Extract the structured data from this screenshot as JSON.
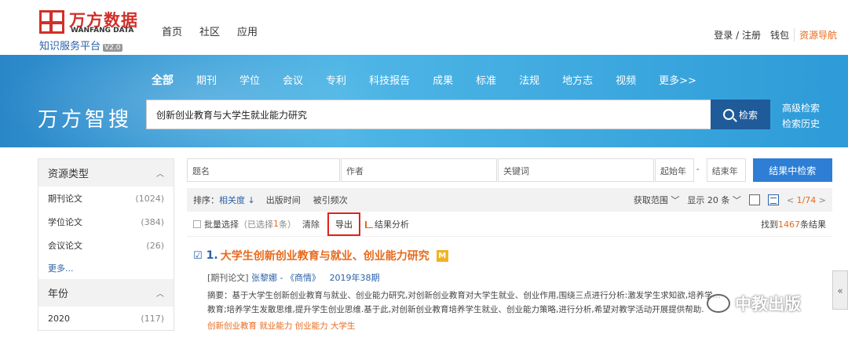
{
  "header": {
    "logo_cn": "万方数据",
    "logo_en": "WANFANG DATA",
    "platform": "知识服务平台",
    "version": "V2.0",
    "nav": [
      "首页",
      "社区",
      "应用"
    ],
    "login": "登录 / 注册",
    "wallet": "钱包",
    "resource_nav": "资源导航"
  },
  "banner": {
    "categories": [
      "全部",
      "期刊",
      "学位",
      "会议",
      "专利",
      "科技报告",
      "成果",
      "标准",
      "法规",
      "地方志",
      "视频",
      "更多>>"
    ],
    "brand": "万方智搜",
    "search_value": "创新创业教育与大学生就业能力研究",
    "search_button": "检索",
    "advanced": "高级检索",
    "history": "检索历史"
  },
  "sidebar": {
    "resource_type": "资源类型",
    "items": [
      {
        "label": "期刊论文",
        "count": "(1024)"
      },
      {
        "label": "学位论文",
        "count": "(384)"
      },
      {
        "label": "会议论文",
        "count": "(26)"
      }
    ],
    "more": "更多...",
    "year_title": "年份",
    "year_items": [
      {
        "label": "2020",
        "count": "(117)"
      }
    ]
  },
  "filters": {
    "title_ph": "题名",
    "author_ph": "作者",
    "keyword_ph": "关键词",
    "start_year": "起始年",
    "dash": "-",
    "end_year": "结束年",
    "search_in_results": "结果中检索"
  },
  "sortbar": {
    "label": "排序：",
    "relevance": "相关度",
    "pubtime": "出版时间",
    "cited": "被引频次",
    "range": "获取范围",
    "show": "显示 20 条",
    "page_prefix": "<",
    "page": "1/74",
    "page_suffix": ">"
  },
  "actions": {
    "batch": "批量选择",
    "selected": "（已选择",
    "selected_count": "1",
    "selected_suffix": "条）",
    "clear": "清除",
    "export": "导出",
    "analysis": "结果分析",
    "found_prefix": "找到",
    "found_count": "1467",
    "found_suffix": "条结果"
  },
  "result": {
    "number": "1.",
    "title": "大学生创新创业教育与就业、创业能力研究",
    "badge": "M",
    "type": "[期刊论文]",
    "author": "张黎娜",
    "source": " - 《商情》",
    "year": "2019年38期",
    "abstract_line1": "摘要：基于大学生创新创业教育与就业、创业能力研究,对创新创业教育对大学生就业、创业作用,围绕三点进行分析:激发学生求知欲,培养学…",
    "abstract_line2": "教育;培养学生发散思维,提升学生创业思维.基于此,对创新创业教育培养学生就业、创业能力策略,进行分析,希望对教学活动开展提供帮助.",
    "keywords": "创新创业教育  就业能力  创业能力  大学生"
  },
  "watermark": "中教出版",
  "side_handle": "«"
}
